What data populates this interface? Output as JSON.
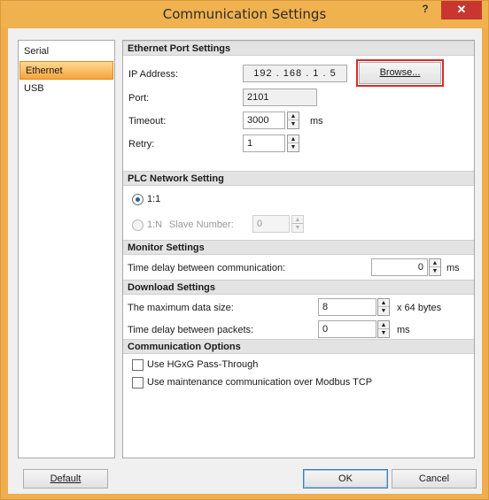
{
  "window": {
    "title": "Communication Settings",
    "help": "?",
    "close": "✕"
  },
  "sidebar": {
    "items": [
      {
        "label": "Serial"
      },
      {
        "label": "Ethernet"
      },
      {
        "label": "USB"
      }
    ]
  },
  "ethernet": {
    "header": "Ethernet Port Settings",
    "ip_label": "IP Address:",
    "ip_value": "192 . 168 . 1 . 5",
    "browse": "Browse...",
    "port_label": "Port:",
    "port_value": "2101",
    "timeout_label": "Timeout:",
    "timeout_value": "3000",
    "timeout_unit": "ms",
    "retry_label": "Retry:",
    "retry_value": "1"
  },
  "plc": {
    "header": "PLC Network Setting",
    "opt_1to1": "1:1",
    "opt_1toN": "1:N",
    "slave_label": "Slave Number:",
    "slave_value": "0"
  },
  "monitor": {
    "header": "Monitor Settings",
    "delay_label": "Time delay between communication:",
    "delay_value": "0",
    "delay_unit": "ms"
  },
  "download": {
    "header": "Download Settings",
    "max_label": "The maximum data size:",
    "max_value": "8",
    "max_unit": "x 64 bytes",
    "packet_label": "Time delay between packets:",
    "packet_value": "0",
    "packet_unit": "ms"
  },
  "options": {
    "header": "Communication Options",
    "hgxg": "Use HGxG Pass-Through",
    "modbus": "Use maintenance communication over Modbus TCP"
  },
  "footer": {
    "default": "Default",
    "ok": "OK",
    "cancel": "Cancel"
  }
}
